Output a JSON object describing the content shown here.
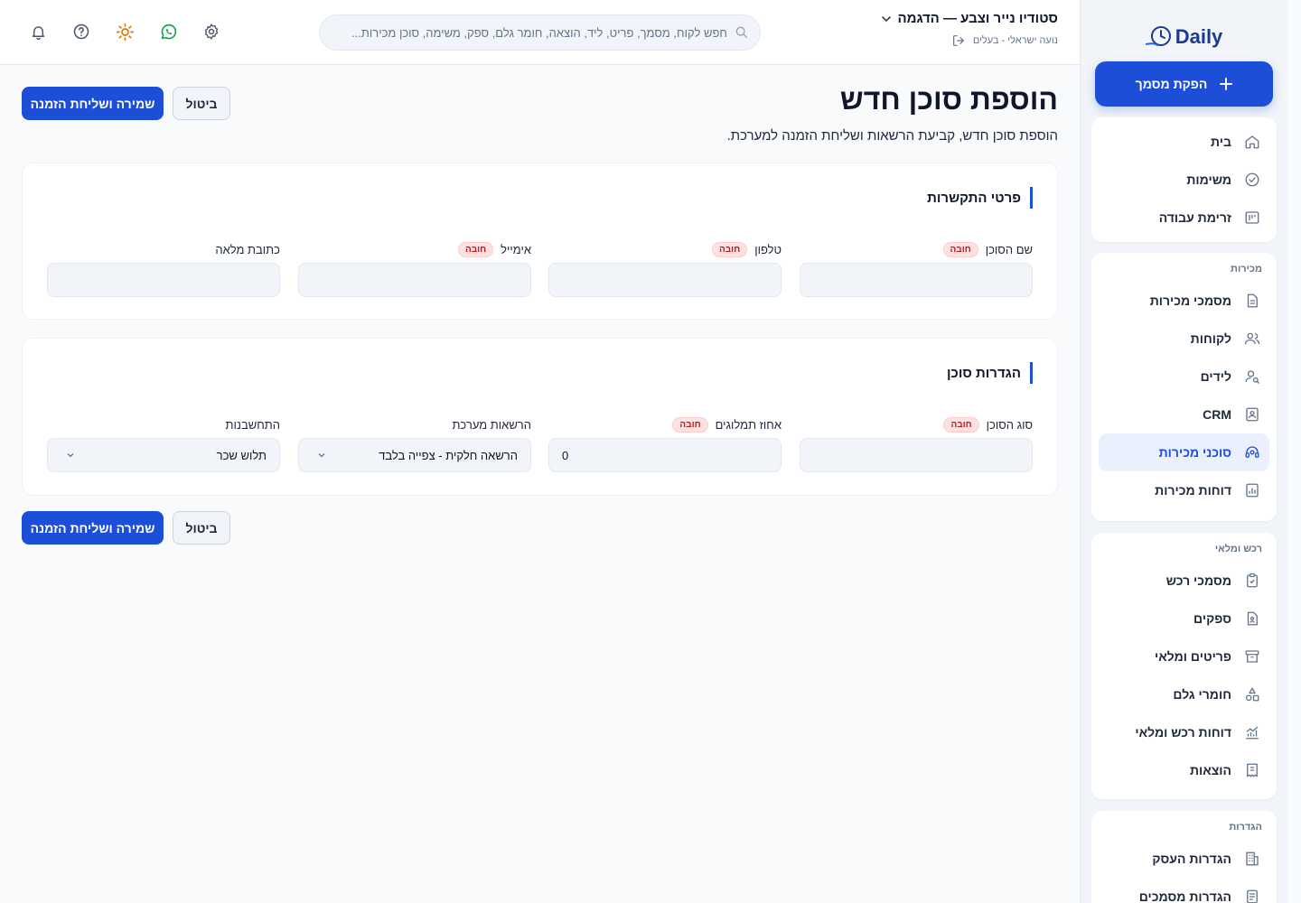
{
  "sidebar": {
    "logo_text": "Daily",
    "primary_action": "הפקת מסמך",
    "groups": [
      {
        "heading": "",
        "items": [
          {
            "label": "בית",
            "icon": "home-icon"
          },
          {
            "label": "משימות",
            "icon": "check-circle-icon"
          },
          {
            "label": "זרימת עבודה",
            "icon": "kanban-icon"
          }
        ]
      },
      {
        "heading": "מכירות",
        "items": [
          {
            "label": "מסמכי מכירות",
            "icon": "document-icon"
          },
          {
            "label": "לקוחות",
            "icon": "users-icon"
          },
          {
            "label": "לידים",
            "icon": "user-search-icon"
          },
          {
            "label": "CRM",
            "icon": "contact-card-icon"
          },
          {
            "label": "סוכני מכירות",
            "icon": "headset-icon",
            "active": true
          },
          {
            "label": "דוחות מכירות",
            "icon": "bar-chart-icon"
          }
        ]
      },
      {
        "heading": "רכש ומלאי",
        "items": [
          {
            "label": "מסמכי רכש",
            "icon": "clipboard-check-icon"
          },
          {
            "label": "ספקים",
            "icon": "supplier-file-icon"
          },
          {
            "label": "פריטים ומלאי",
            "icon": "archive-icon"
          },
          {
            "label": "חומרי גלם",
            "icon": "shapes-icon"
          },
          {
            "label": "דוחות רכש ומלאי",
            "icon": "trend-chart-icon"
          },
          {
            "label": "הוצאות",
            "icon": "receipt-icon"
          }
        ]
      },
      {
        "heading": "הגדרות",
        "items": [
          {
            "label": "הגדרות העסק",
            "icon": "building-icon"
          },
          {
            "label": "הגדרות מסמכים",
            "icon": "document-settings-icon"
          }
        ]
      }
    ]
  },
  "topbar": {
    "company_name": "סטודיו נייר וצבע — הדגמה",
    "user_line": "נועה ישראלי - בעלים",
    "search_placeholder": "חפש לקוח, מסמך, פריט, ליד, הוצאה, חומר גלם, ספק, משימה, סוכן מכירות...",
    "colors": {
      "whatsapp": "#16a34a",
      "sun": "#d97706"
    }
  },
  "page": {
    "title": "הוספת סוכן חדש",
    "subtitle": "הוספת סוכן חדש, קביעת הרשאות ושליחת הזמנה למערכת.",
    "save_label": "שמירה ושליחת הזמנה",
    "cancel_label": "ביטול"
  },
  "contact_section": {
    "title": "פרטי התקשרות",
    "fields": [
      {
        "label": "שם הסוכן",
        "required": "חובה",
        "value": ""
      },
      {
        "label": "טלפון",
        "required": "חובה",
        "value": ""
      },
      {
        "label": "אימייל",
        "required": "חובה",
        "value": ""
      },
      {
        "label": "כתובת מלאה",
        "value": ""
      }
    ]
  },
  "settings_section": {
    "title": "הגדרות סוכן",
    "fields": [
      {
        "label": "סוג הסוכן",
        "required": "חובה",
        "value": ""
      },
      {
        "label": "אחוז תמלוגים",
        "required": "חובה",
        "value": "0"
      },
      {
        "label": "הרשאות מערכת",
        "value": "הרשאה חלקית - צפייה בלבד"
      },
      {
        "label": "התחשבנות",
        "value": "תלוש שכר"
      }
    ]
  },
  "accent_color": "#1d4ed8"
}
